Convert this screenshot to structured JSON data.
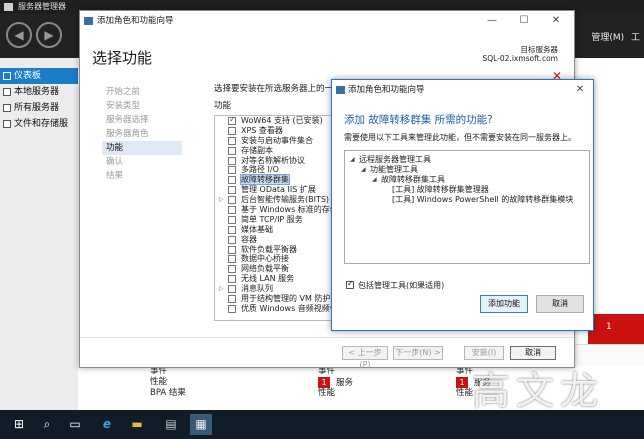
{
  "server_manager": {
    "title": "服务器管理器",
    "menu": [
      "管理(M)",
      "工"
    ],
    "sidebar": [
      {
        "label": "仪表板",
        "active": true
      },
      {
        "label": "本地服务器",
        "active": false
      },
      {
        "label": "所有服务器",
        "active": false
      },
      {
        "label": "文件和存储服",
        "active": false
      }
    ],
    "red_tile_count": "1",
    "tiles": [
      {
        "items": [
          "事件",
          "性能",
          "BPA 结果"
        ]
      },
      {
        "badge": "1",
        "items": [
          "事件",
          "服务",
          "性能"
        ]
      },
      {
        "badge": "1",
        "items": [
          "事件",
          "服务",
          "性能"
        ]
      }
    ]
  },
  "wizard": {
    "window_title": "添加角色和功能向导",
    "heading": "选择功能",
    "target_label": "目标服务器",
    "target_server": "SQL-02.ixmsoft.com",
    "steps": [
      {
        "label": "开始之前",
        "current": false
      },
      {
        "label": "安装类型",
        "current": false
      },
      {
        "label": "服务器选择",
        "current": false
      },
      {
        "label": "服务器角色",
        "current": false
      },
      {
        "label": "功能",
        "current": true
      },
      {
        "label": "确认",
        "current": false
      },
      {
        "label": "结果",
        "current": false
      }
    ],
    "description": "选择要安装在所选服务器上的一个或多个功能。",
    "features_label": "功能",
    "features": [
      {
        "label": "WoW64 支持 (已安装)",
        "checked": true,
        "expand": false,
        "selected": false
      },
      {
        "label": "XPS 查看器",
        "checked": false,
        "expand": false,
        "selected": false
      },
      {
        "label": "安装与启动事件集合",
        "checked": false,
        "expand": false,
        "selected": false
      },
      {
        "label": "存储副本",
        "checked": false,
        "expand": false,
        "selected": false
      },
      {
        "label": "对等名称解析协议",
        "checked": false,
        "expand": false,
        "selected": false
      },
      {
        "label": "多路径 I/O",
        "checked": false,
        "expand": false,
        "selected": false
      },
      {
        "label": "故障转移群集",
        "checked": false,
        "expand": false,
        "selected": true
      },
      {
        "label": "管理 OData IIS 扩展",
        "checked": false,
        "expand": false,
        "selected": false
      },
      {
        "label": "后台智能传输服务(BITS)",
        "checked": false,
        "expand": true,
        "selected": false
      },
      {
        "label": "基于 Windows 标准的存储",
        "checked": false,
        "expand": false,
        "selected": false
      },
      {
        "label": "简单 TCP/IP 服务",
        "checked": false,
        "expand": false,
        "selected": false
      },
      {
        "label": "媒体基础",
        "checked": false,
        "expand": false,
        "selected": false
      },
      {
        "label": "容器",
        "checked": false,
        "expand": false,
        "selected": false
      },
      {
        "label": "软件负载平衡器",
        "checked": false,
        "expand": false,
        "selected": false
      },
      {
        "label": "数据中心桥接",
        "checked": false,
        "expand": false,
        "selected": false
      },
      {
        "label": "网络负载平衡",
        "checked": false,
        "expand": false,
        "selected": false
      },
      {
        "label": "无线 LAN 服务",
        "checked": false,
        "expand": false,
        "selected": false
      },
      {
        "label": "消息队列",
        "checked": false,
        "expand": true,
        "selected": false
      },
      {
        "label": "用于结构管理的 VM 防护工",
        "checked": false,
        "expand": false,
        "selected": false
      },
      {
        "label": "优质 Windows 音频视频体",
        "checked": false,
        "expand": false,
        "selected": false
      }
    ],
    "buttons": {
      "prev": "< 上一步(P)",
      "next": "下一步(N) >",
      "install": "安装(I)",
      "cancel": "取消"
    }
  },
  "dialog": {
    "title": "添加角色和功能向导",
    "heading": "添加 故障转移群集 所需的功能?",
    "description": "需要使用以下工具来管理此功能，但不需要安装在同一服务器上。",
    "tree": [
      {
        "label": "远程服务器管理工具",
        "level": 0,
        "expander": true
      },
      {
        "label": "功能管理工具",
        "level": 1,
        "expander": true
      },
      {
        "label": "故障转移群集工具",
        "level": 2,
        "expander": true
      },
      {
        "label": "[工具] 故障转移群集管理器",
        "level": 3,
        "expander": false
      },
      {
        "label": "[工具] Windows PowerShell 的故障转移群集模块",
        "level": 3,
        "expander": false
      }
    ],
    "include_tools": "包括管理工具(如果适用)",
    "include_checked": true,
    "add_button": "添加功能",
    "cancel_button": "取消"
  },
  "watermark": "高文龙"
}
